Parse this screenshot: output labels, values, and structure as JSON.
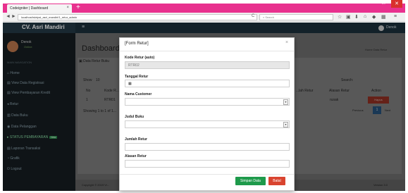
{
  "browser": {
    "tab_title": "Codeigniter | Dashboard",
    "tab_close": "×",
    "new_tab": "+",
    "url": "localhost/skripsi_asri_mandiri/1_retur_admin",
    "search_placeholder": "Search",
    "back": "◄",
    "forward": "►",
    "reload": "C",
    "min": "–",
    "max": "□",
    "close": "✕"
  },
  "app": {
    "brand": "CV. Asri Mandiri",
    "hamburger": "≡",
    "user_name": "Denok",
    "page_title": "Dashboard",
    "breadcrumb": "Home  Data Retur",
    "box_title": "Data Retur Buku",
    "footer_left": "Copyright © 2019 Vi...",
    "footer_right": "Version 3.0"
  },
  "sidebar": {
    "profile_name": "Denok",
    "profile_status": "Online",
    "menu_header": "MAIN NAVIGATION",
    "items": [
      {
        "label": "Home"
      },
      {
        "label": "View Data Registrasi"
      },
      {
        "label": "View Pembayaran Kredit"
      },
      {
        "label": "Retur"
      },
      {
        "label": "Data Buku"
      },
      {
        "label": "Data Pelanggan"
      },
      {
        "label": "STATUS PEMBAYARAN",
        "badge": "New"
      },
      {
        "label": "Laporan Transaksi"
      },
      {
        "label": "Grafik"
      },
      {
        "label": "Logout"
      }
    ]
  },
  "table_bg": {
    "show": "Show",
    "entries": "10",
    "search": "Search:",
    "col_no": "No",
    "col_kode": "Kode R...",
    "col_tanggal": "...lah Retur",
    "col_alasan": "Alasan Retur",
    "col_action": "Action",
    "row_no": "1",
    "row_kode": "RTR01",
    "row_alasan": "rusak",
    "row_action": "Hapus",
    "info": "Showing 1 to 1 of 1...",
    "prev": "Previous",
    "page": "1",
    "next": "Next"
  },
  "modal": {
    "title": "[Form Retur]",
    "close": "×",
    "fields": {
      "kode_label": "Kode Retur (auto)",
      "kode_value": "RTR02",
      "tanggal_label": "Tanggal Retur",
      "tanggal_icon": "▦",
      "customer_label": "Nama Customer",
      "customer_value": "",
      "judul_label": "Judul Buku",
      "judul_value": "",
      "jumlah_label": "Jumlah Retur",
      "jumlah_value": "",
      "alasan_label": "Alasan Retur",
      "alasan_value": ""
    },
    "save_label": "Simpan Data",
    "cancel_label": "Batal"
  },
  "colors": {
    "tabbar": "#e8318e",
    "sidebar": "#161d21",
    "header": "#1b2e3a",
    "save": "#1e9a4b",
    "cancel": "#d9442f"
  }
}
